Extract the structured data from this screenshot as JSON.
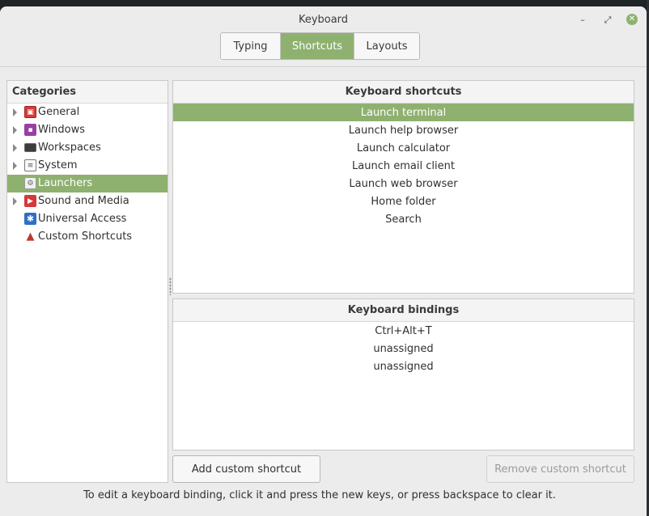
{
  "window": {
    "title": "Keyboard",
    "controls": {
      "minimize": "–",
      "maximize": "⤢",
      "close": "✕"
    }
  },
  "tabs": [
    {
      "label": "Typing",
      "active": false
    },
    {
      "label": "Shortcuts",
      "active": true
    },
    {
      "label": "Layouts",
      "active": false
    }
  ],
  "categories": {
    "header": "Categories",
    "items": [
      {
        "label": "General",
        "icon": "general-icon",
        "expandable": true
      },
      {
        "label": "Windows",
        "icon": "windows-icon",
        "expandable": true
      },
      {
        "label": "Workspaces",
        "icon": "workspaces-icon",
        "expandable": true
      },
      {
        "label": "System",
        "icon": "system-icon",
        "expandable": true
      },
      {
        "label": "Launchers",
        "icon": "launchers-icon",
        "expandable": false,
        "selected": true
      },
      {
        "label": "Sound and Media",
        "icon": "sound-media-icon",
        "expandable": true
      },
      {
        "label": "Universal Access",
        "icon": "universal-access-icon",
        "expandable": false
      },
      {
        "label": "Custom Shortcuts",
        "icon": "custom-shortcuts-icon",
        "expandable": false
      }
    ]
  },
  "shortcuts": {
    "header": "Keyboard shortcuts",
    "items": [
      "Launch terminal",
      "Launch help browser",
      "Launch calculator",
      "Launch email client",
      "Launch web browser",
      "Home folder",
      "Search"
    ],
    "selected_index": 0
  },
  "bindings": {
    "header": "Keyboard bindings",
    "items": [
      "Ctrl+Alt+T",
      "unassigned",
      "unassigned"
    ]
  },
  "buttons": {
    "add": "Add custom shortcut",
    "remove": "Remove custom shortcut"
  },
  "hint": "To edit a keyboard binding, click it and press the new keys, or press backspace to clear it.",
  "colors": {
    "accent": "#8fb170"
  }
}
